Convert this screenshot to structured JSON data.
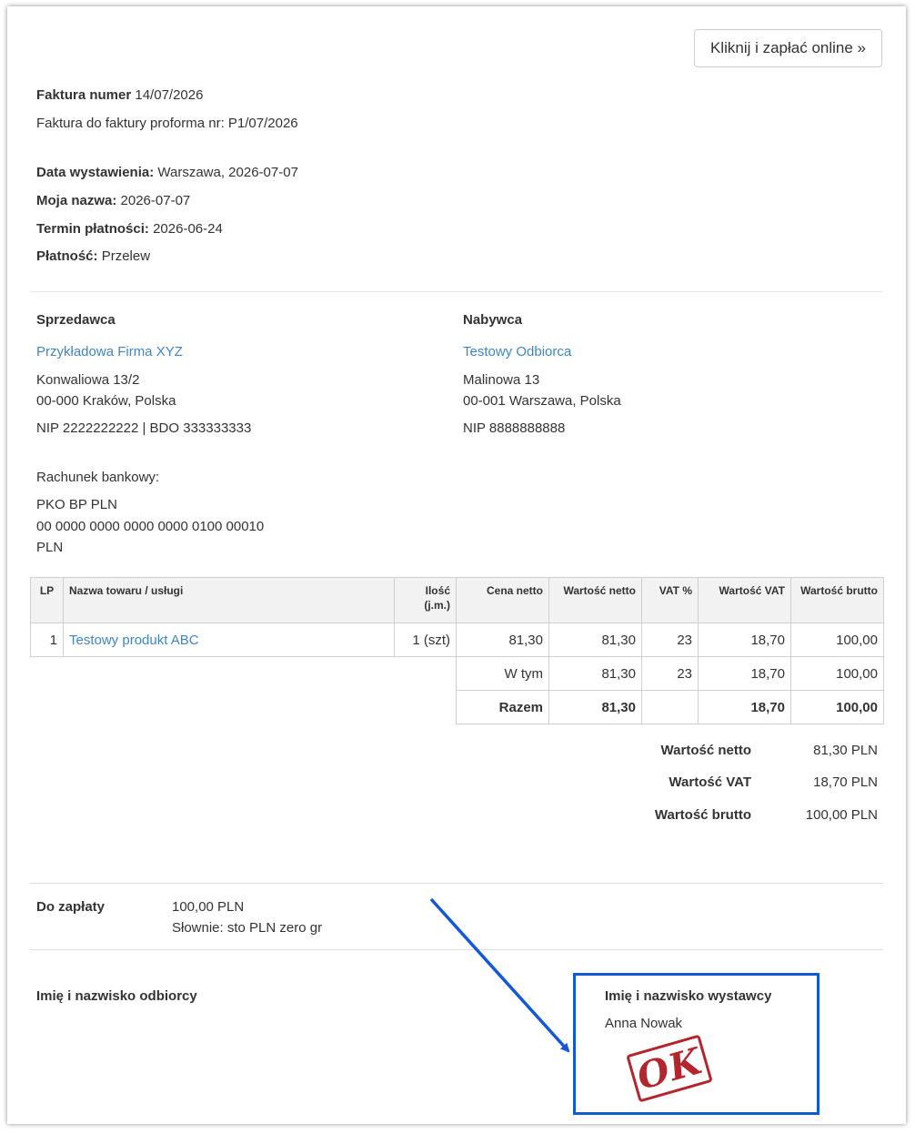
{
  "pay_button_label": "Kliknij i zapłać online »",
  "invoice": {
    "number_label": "Faktura numer",
    "number": "14/07/2026",
    "proforma_text": "Faktura do faktury proforma nr: P1/07/2026",
    "issue_date_label": "Data wystawienia:",
    "issue_date": "Warszawa, 2026-07-07",
    "my_name_label": "Moja nazwa:",
    "my_name": "2026-07-07",
    "due_date_label": "Termin płatności:",
    "due_date": "2026-06-24",
    "payment_label": "Płatność:",
    "payment": "Przelew"
  },
  "seller": {
    "heading": "Sprzedawca",
    "name": "Przykładowa Firma XYZ",
    "street": "Konwaliowa 13/2",
    "city": "00-000 Kraków, Polska",
    "ids": "NIP 2222222222 | BDO 333333333"
  },
  "buyer": {
    "heading": "Nabywca",
    "name": "Testowy Odbiorca",
    "street": "Malinowa 13",
    "city": "00-001 Warszawa, Polska",
    "ids": "NIP 8888888888"
  },
  "bank": {
    "label": "Rachunek bankowy:",
    "name": "PKO BP PLN",
    "number": "00 0000 0000 0000 0000 0100 00010",
    "currency": "PLN"
  },
  "table": {
    "headers": [
      "LP",
      "Nazwa towaru / usługi",
      "Ilość",
      "(j.m.)",
      "Cena netto",
      "Wartość netto",
      "VAT %",
      "Wartość VAT",
      "Wartość brutto"
    ],
    "row": {
      "lp": "1",
      "name": "Testowy produkt ABC",
      "qty": "1 (szt)",
      "price": "81,30",
      "net": "81,30",
      "vat_rate": "23",
      "vat": "18,70",
      "gross": "100,00"
    },
    "subtotal": {
      "label": "W tym",
      "net": "81,30",
      "vat_rate": "23",
      "vat": "18,70",
      "gross": "100,00"
    },
    "total": {
      "label": "Razem",
      "net": "81,30",
      "vat": "18,70",
      "gross": "100,00"
    }
  },
  "totals": {
    "net_label": "Wartość netto",
    "net": "81,30 PLN",
    "vat_label": "Wartość VAT",
    "vat": "18,70 PLN",
    "gross_label": "Wartość brutto",
    "gross": "100,00 PLN"
  },
  "due": {
    "label": "Do zapłaty",
    "amount": "100,00 PLN",
    "words": "Słownie: sto PLN zero gr"
  },
  "signatures": {
    "recipient_label": "Imię i nazwisko odbiorcy",
    "issuer_label": "Imię i nazwisko wystawcy",
    "issuer_name": "Anna Nowak",
    "stamp_text": "OK"
  },
  "colors": {
    "link": "#3f86c6",
    "highlight": "#1558d6",
    "stamp": "#b3262e"
  }
}
